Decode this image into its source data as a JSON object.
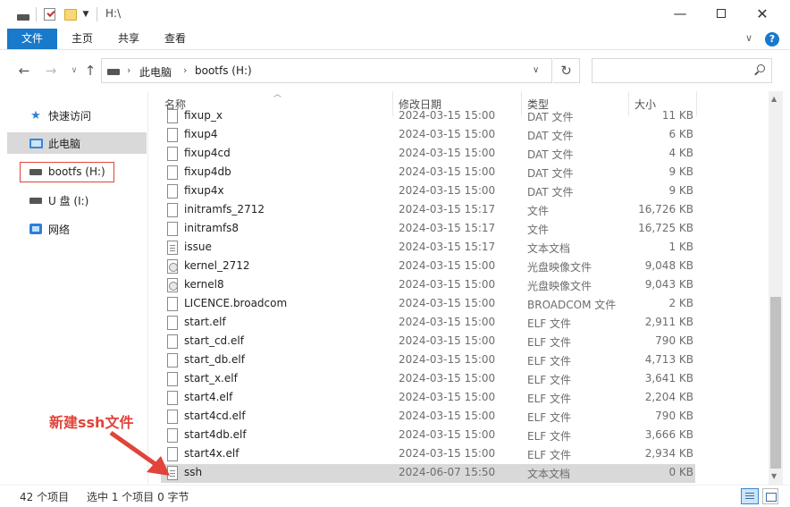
{
  "window": {
    "path_title": "H:\\",
    "minimize": "—",
    "close": "✕"
  },
  "ribbon": {
    "file": "文件",
    "home": "主页",
    "share": "共享",
    "view": "查看",
    "help": "?"
  },
  "address": {
    "segments": [
      "此电脑",
      "bootfs (H:)"
    ],
    "search_placeholder": ""
  },
  "sidebar": {
    "items": [
      {
        "label": "快速访问",
        "icon": "star-icon"
      },
      {
        "label": "此电脑",
        "icon": "computer-icon"
      },
      {
        "label": "bootfs (H:)",
        "icon": "drive-icon"
      },
      {
        "label": "U 盘 (I:)",
        "icon": "drive-icon"
      },
      {
        "label": "网络",
        "icon": "network-icon"
      }
    ]
  },
  "columns": {
    "name": "名称",
    "date": "修改日期",
    "type": "类型",
    "size": "大小"
  },
  "files": [
    {
      "name": "fixup_x",
      "date": "2024-03-15 15:00",
      "type": "DAT 文件",
      "size": "11 KB",
      "icon": "file"
    },
    {
      "name": "fixup4",
      "date": "2024-03-15 15:00",
      "type": "DAT 文件",
      "size": "6 KB",
      "icon": "file"
    },
    {
      "name": "fixup4cd",
      "date": "2024-03-15 15:00",
      "type": "DAT 文件",
      "size": "4 KB",
      "icon": "file"
    },
    {
      "name": "fixup4db",
      "date": "2024-03-15 15:00",
      "type": "DAT 文件",
      "size": "9 KB",
      "icon": "file"
    },
    {
      "name": "fixup4x",
      "date": "2024-03-15 15:00",
      "type": "DAT 文件",
      "size": "9 KB",
      "icon": "file"
    },
    {
      "name": "initramfs_2712",
      "date": "2024-03-15 15:17",
      "type": "文件",
      "size": "16,726 KB",
      "icon": "file"
    },
    {
      "name": "initramfs8",
      "date": "2024-03-15 15:17",
      "type": "文件",
      "size": "16,725 KB",
      "icon": "file"
    },
    {
      "name": "issue",
      "date": "2024-03-15 15:17",
      "type": "文本文档",
      "size": "1 KB",
      "icon": "doc"
    },
    {
      "name": "kernel_2712",
      "date": "2024-03-15 15:00",
      "type": "光盘映像文件",
      "size": "9,048 KB",
      "icon": "disc"
    },
    {
      "name": "kernel8",
      "date": "2024-03-15 15:00",
      "type": "光盘映像文件",
      "size": "9,043 KB",
      "icon": "disc"
    },
    {
      "name": "LICENCE.broadcom",
      "date": "2024-03-15 15:00",
      "type": "BROADCOM 文件",
      "size": "2 KB",
      "icon": "file"
    },
    {
      "name": "start.elf",
      "date": "2024-03-15 15:00",
      "type": "ELF 文件",
      "size": "2,911 KB",
      "icon": "file"
    },
    {
      "name": "start_cd.elf",
      "date": "2024-03-15 15:00",
      "type": "ELF 文件",
      "size": "790 KB",
      "icon": "file"
    },
    {
      "name": "start_db.elf",
      "date": "2024-03-15 15:00",
      "type": "ELF 文件",
      "size": "4,713 KB",
      "icon": "file"
    },
    {
      "name": "start_x.elf",
      "date": "2024-03-15 15:00",
      "type": "ELF 文件",
      "size": "3,641 KB",
      "icon": "file"
    },
    {
      "name": "start4.elf",
      "date": "2024-03-15 15:00",
      "type": "ELF 文件",
      "size": "2,204 KB",
      "icon": "file"
    },
    {
      "name": "start4cd.elf",
      "date": "2024-03-15 15:00",
      "type": "ELF 文件",
      "size": "790 KB",
      "icon": "file"
    },
    {
      "name": "start4db.elf",
      "date": "2024-03-15 15:00",
      "type": "ELF 文件",
      "size": "3,666 KB",
      "icon": "file"
    },
    {
      "name": "start4x.elf",
      "date": "2024-03-15 15:00",
      "type": "ELF 文件",
      "size": "2,934 KB",
      "icon": "file"
    },
    {
      "name": "ssh",
      "date": "2024-06-07 15:50",
      "type": "文本文档",
      "size": "0 KB",
      "icon": "doc",
      "selected": true
    }
  ],
  "annotation": {
    "text": "新建ssh文件",
    "color": "#e0443a"
  },
  "status": {
    "count": "42 个项目",
    "selection": "选中 1 个项目  0 字节"
  },
  "colors": {
    "accent": "#1979ca",
    "selection": "#d9d9d9"
  }
}
